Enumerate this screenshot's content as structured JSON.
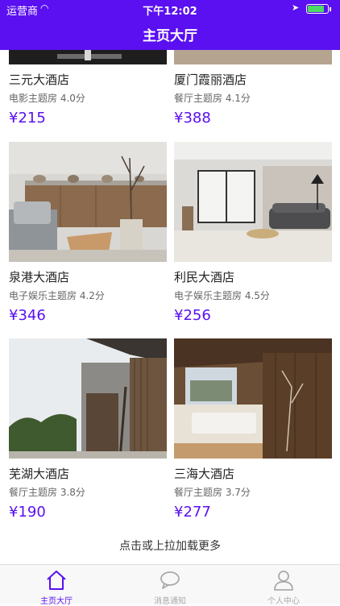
{
  "status_bar": {
    "carrier": "运营商",
    "time": "下午12:02"
  },
  "header": {
    "title": "主页大厅"
  },
  "hotels": [
    {
      "name": "三元大酒店",
      "meta": "电影主题房 4.0分",
      "price": "¥215"
    },
    {
      "name": "厦门霞丽酒店",
      "meta": "餐厅主题房 4.1分",
      "price": "¥388"
    },
    {
      "name": "泉港大酒店",
      "meta": "电子娱乐主题房 4.2分",
      "price": "¥346"
    },
    {
      "name": "利民大酒店",
      "meta": "电子娱乐主题房 4.5分",
      "price": "¥256"
    },
    {
      "name": "芜湖大酒店",
      "meta": "餐厅主题房 3.8分",
      "price": "¥190"
    },
    {
      "name": "三海大酒店",
      "meta": "餐厅主题房 3.7分",
      "price": "¥277"
    }
  ],
  "load_more": "点击或上拉加载更多",
  "tabs": [
    {
      "label": "主页大厅",
      "icon": "home-icon",
      "active": true
    },
    {
      "label": "消息通知",
      "icon": "chat-bubble-icon",
      "active": false
    },
    {
      "label": "个人中心",
      "icon": "user-icon",
      "active": false
    }
  ],
  "colors": {
    "accent": "#5a10f0",
    "inactive": "#aaaaaa"
  }
}
